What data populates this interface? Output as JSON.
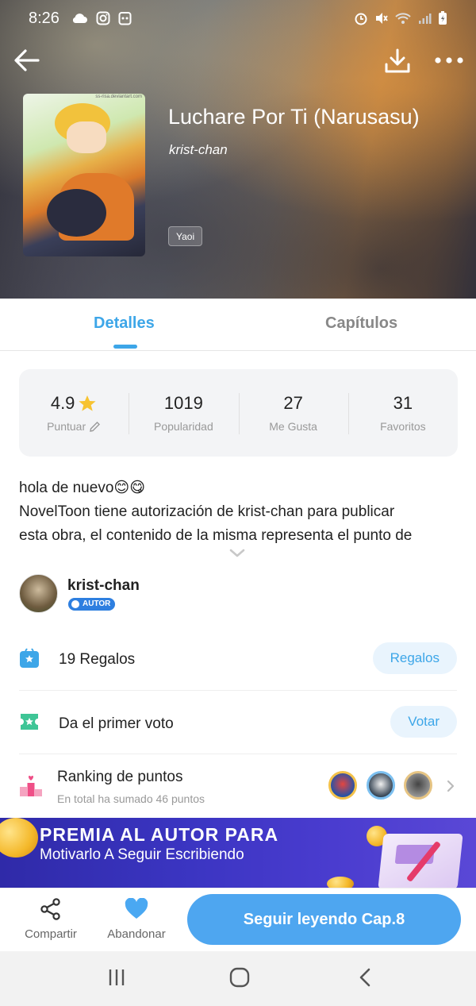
{
  "status_bar": {
    "time": "8:26",
    "left_icons": [
      "cloud-icon",
      "instagram-icon",
      "app-icon"
    ],
    "right_icons": [
      "alarm-icon",
      "mute-icon",
      "wifi-icon",
      "signal-icon",
      "battery-icon"
    ]
  },
  "header": {
    "back_icon": "arrow-left-icon",
    "download_icon": "download-icon",
    "more_icon": "more-dots-icon",
    "cover_watermark": "ss-risa.deviantart.com",
    "title": "Luchare Por Ti (Narusasu)",
    "author": "krist-chan",
    "genre": "Yaoi"
  },
  "tabs": [
    {
      "label": "Detalles",
      "active": true
    },
    {
      "label": "Capítulos",
      "active": false
    }
  ],
  "stats": [
    {
      "value": "4.9",
      "label": "Puntuar",
      "icon": "star-icon",
      "label_icon": "edit-icon"
    },
    {
      "value": "1019",
      "label": "Popularidad"
    },
    {
      "value": "27",
      "label": "Me Gusta"
    },
    {
      "value": "31",
      "label": "Favoritos"
    }
  ],
  "description": {
    "line1": "hola de nuevo😊😋",
    "line2": "NovelToon tiene autorización de krist-chan para publicar",
    "line3": "esta obra, el contenido de la misma representa el punto de"
  },
  "author": {
    "name": "krist-chan",
    "badge": "AUTOR"
  },
  "gifts": {
    "count": "19",
    "label": "Regalos",
    "button": "Regalos"
  },
  "vote": {
    "label": "Da el primer voto",
    "button": "Votar"
  },
  "ranking": {
    "title": "Ranking de puntos",
    "subtitle": "En total ha sumado 46 puntos"
  },
  "banner": {
    "title": "PREMIA AL AUTOR PARA",
    "subtitle": "Motivarlo A Seguir Escribiendo"
  },
  "actions": {
    "share": "Compartir",
    "abandon": "Abandonar",
    "read": "Seguir leyendo Cap.8"
  },
  "colors": {
    "accent": "#3da6e8",
    "read_button": "#4ea6f0",
    "banner": "#3b35c2"
  }
}
